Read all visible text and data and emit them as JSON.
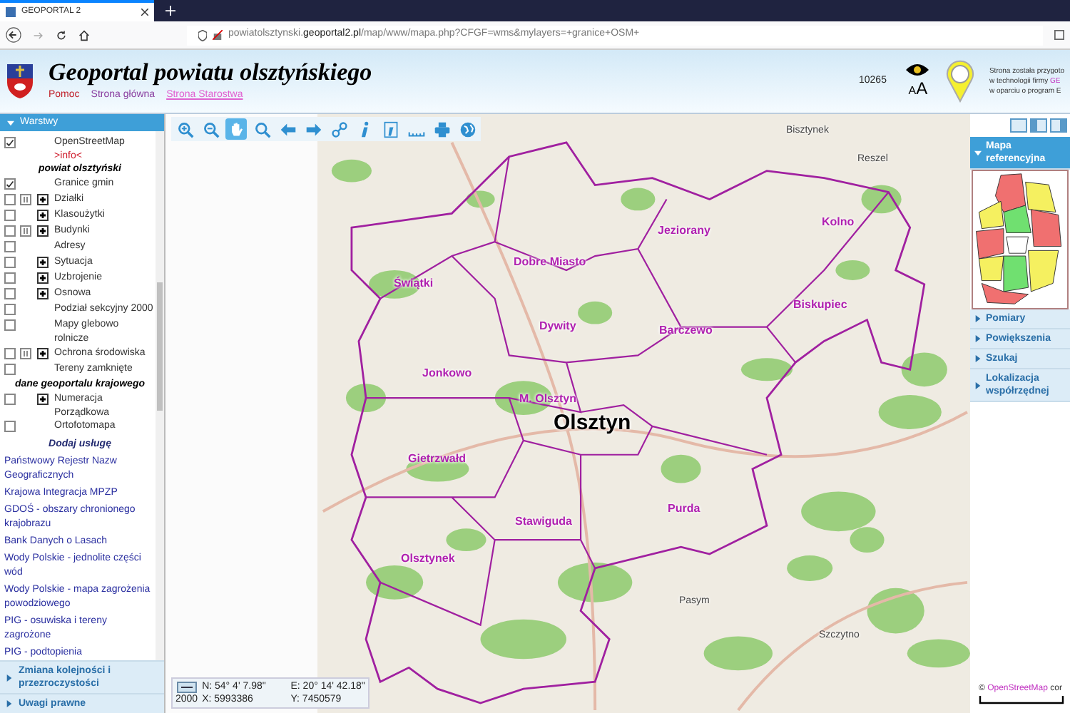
{
  "browser": {
    "tab_title": "GEOPORTAL 2",
    "url_host": "powiatolsztynski.",
    "url_domain": "geoportal2.pl",
    "url_path": "/map/www/mapa.php?CFGF=wms&mylayers=+granice+OSM+"
  },
  "header": {
    "title": "Geoportal powiatu olsztyńskiego",
    "links": [
      {
        "label": "Pomoc",
        "kind": "help"
      },
      {
        "label": "Strona główna",
        "kind": "plain"
      },
      {
        "label": "Strona Starostwa",
        "kind": "external"
      }
    ],
    "counter": "10265",
    "font_toggle": [
      "A",
      "A"
    ],
    "credit": [
      {
        "text": "Strona została przygoto"
      },
      {
        "text": "w technologii firmy ",
        "link": "GE"
      },
      {
        "text": "w oparciu o program E"
      }
    ]
  },
  "layers": {
    "title": "Warstwy",
    "expanded": true,
    "items": [
      {
        "kind": "layer",
        "label": "OpenStreetMap",
        "sublink": ">info<",
        "checked": true,
        "info": false,
        "expandable": false
      },
      {
        "kind": "heading",
        "label": "powiat olsztyński"
      },
      {
        "kind": "layer",
        "label": "Granice gmin",
        "checked": true,
        "info": false,
        "expandable": false
      },
      {
        "kind": "layer",
        "label": "Działki",
        "checked": false,
        "info": true,
        "expandable": true
      },
      {
        "kind": "layer",
        "label": "Klasoużytki",
        "checked": false,
        "info": false,
        "expandable": true
      },
      {
        "kind": "layer",
        "label": "Budynki",
        "checked": false,
        "info": true,
        "expandable": true
      },
      {
        "kind": "layer",
        "label": "Adresy",
        "checked": false,
        "info": false,
        "expandable": false
      },
      {
        "kind": "layer",
        "label": "Sytuacja",
        "checked": false,
        "info": false,
        "expandable": true
      },
      {
        "kind": "layer",
        "label": "Uzbrojenie",
        "checked": false,
        "info": false,
        "expandable": true
      },
      {
        "kind": "layer",
        "label": "Osnowa",
        "checked": false,
        "info": false,
        "expandable": true
      },
      {
        "kind": "layer",
        "label": "Podział sekcyjny 2000",
        "checked": false,
        "info": false,
        "expandable": false
      },
      {
        "kind": "layer",
        "label": "Mapy glebowo rolnicze",
        "checked": false,
        "info": false,
        "expandable": false
      },
      {
        "kind": "layer",
        "label": "Ochrona środowiska",
        "checked": false,
        "info": true,
        "expandable": true
      },
      {
        "kind": "layer",
        "label": "Tereny zamknięte",
        "checked": false,
        "info": false,
        "expandable": false
      },
      {
        "kind": "heading",
        "label": "dane geoportalu krajowego"
      },
      {
        "kind": "layer",
        "label": "Numeracja Porządkowa",
        "checked": false,
        "info": false,
        "expandable": true
      },
      {
        "kind": "layer",
        "label": "Ortofotomapa",
        "checked": false,
        "info": false,
        "expandable": false
      }
    ]
  },
  "services": {
    "title": "Dodaj usługę",
    "links": [
      "Państwowy Rejestr Nazw Geograficznych",
      "Krajowa Integracja MPZP",
      "GDOŚ - obszary chronionego krajobrazu",
      "Bank Danych o Lasach",
      "Wody Polskie - jednolite części wód",
      "Wody Polskie - mapa zagrożenia powodziowego",
      "PIG - osuwiska i tereny zagrożone",
      "PIG - podtopienia"
    ]
  },
  "left_sections": [
    {
      "label": "Zmiana kolejności i przezroczystości",
      "expanded": false
    },
    {
      "label": "Uwagi prawne",
      "expanded": false
    }
  ],
  "toolbar": [
    {
      "kind": "zoom-in",
      "selected": false
    },
    {
      "kind": "zoom-out",
      "selected": false
    },
    {
      "kind": "pan",
      "selected": true
    },
    {
      "kind": "zoom-box",
      "selected": false
    },
    {
      "kind": "back",
      "selected": false
    },
    {
      "kind": "forward",
      "selected": false
    },
    {
      "kind": "link",
      "selected": false
    },
    {
      "kind": "info",
      "selected": false
    },
    {
      "kind": "info-box",
      "selected": false
    },
    {
      "kind": "measure",
      "selected": false
    },
    {
      "kind": "print",
      "selected": false
    },
    {
      "kind": "globe",
      "selected": false
    }
  ],
  "map": {
    "labels": [
      {
        "text": "Dobre Miasto",
        "kind": "commune"
      },
      {
        "text": "Jeziorany",
        "kind": "commune"
      },
      {
        "text": "Kolno",
        "kind": "commune"
      },
      {
        "text": "Świątki",
        "kind": "commune"
      },
      {
        "text": "Dywity",
        "kind": "commune"
      },
      {
        "text": "Barczewo",
        "kind": "commune"
      },
      {
        "text": "Biskupiec",
        "kind": "commune"
      },
      {
        "text": "Jonkowo",
        "kind": "commune"
      },
      {
        "text": "M. Olsztyn",
        "kind": "commune"
      },
      {
        "text": "Olsztyn",
        "kind": "city"
      },
      {
        "text": "Gietrzwałd",
        "kind": "commune"
      },
      {
        "text": "Stawiguda",
        "kind": "commune"
      },
      {
        "text": "Purda",
        "kind": "commune"
      },
      {
        "text": "Olsztynek",
        "kind": "commune"
      },
      {
        "text": "Bisztynek",
        "kind": "town"
      },
      {
        "text": "Reszel",
        "kind": "town"
      },
      {
        "text": "Pasym",
        "kind": "town"
      },
      {
        "text": "Szczytno",
        "kind": "town"
      }
    ],
    "coords": {
      "scale": "2000",
      "n": "N: 54° 4' 7.98\"",
      "e": "E: 20° 14' 42.18\"",
      "x": "X: 5993386",
      "y": "Y: 7450579"
    }
  },
  "right_panel": {
    "sections": [
      {
        "label": "Mapa referencyjna",
        "expanded": true
      },
      {
        "label": "Pomiary",
        "expanded": false
      },
      {
        "label": "Powiększenia",
        "expanded": false
      },
      {
        "label": "Szukaj",
        "expanded": false
      },
      {
        "label": "Lokalizacja współrzędnej",
        "expanded": false
      }
    ],
    "attribution": {
      "prefix": "© ",
      "link": "OpenStreetMap",
      "suffix": " cor"
    }
  }
}
